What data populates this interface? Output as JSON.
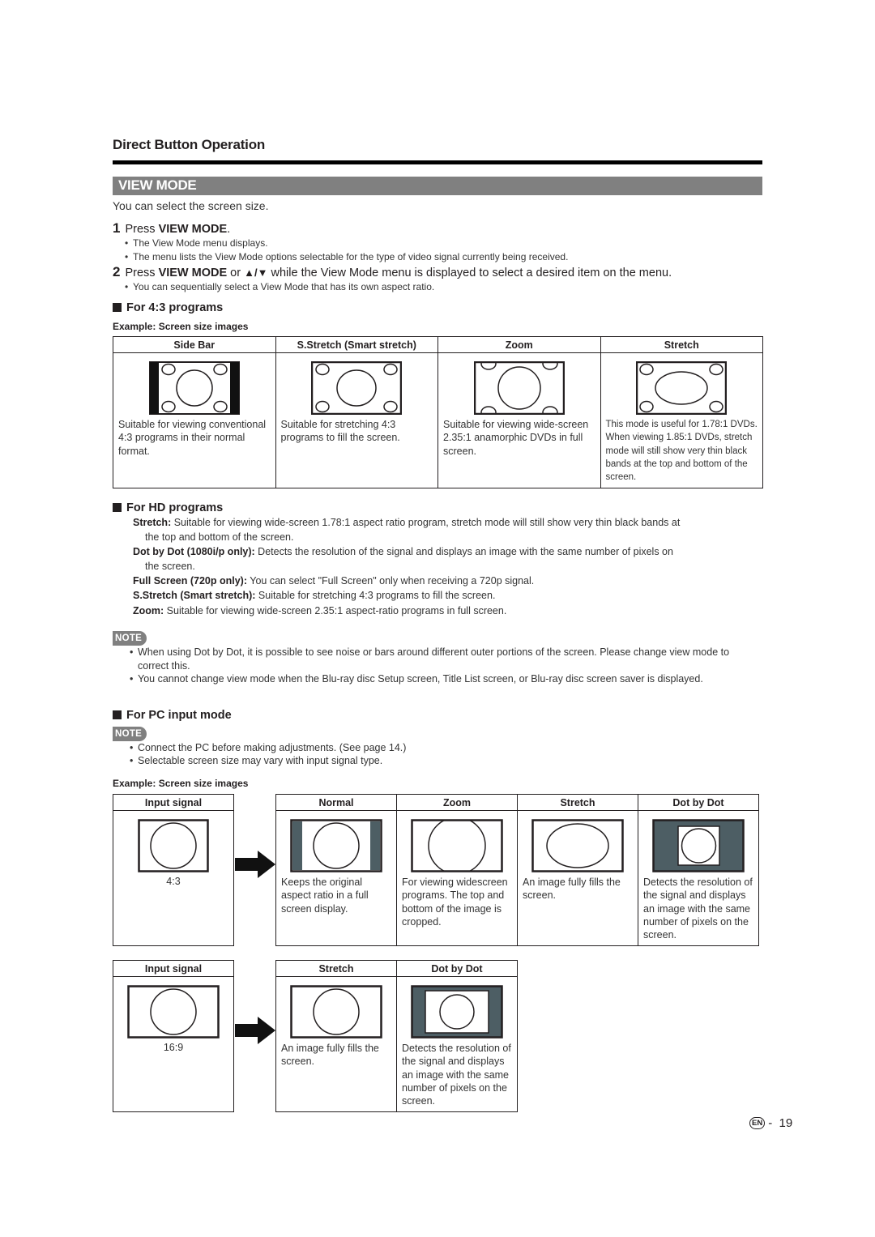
{
  "section_title": "Direct Button Operation",
  "heading": "VIEW MODE",
  "intro": "You can select the screen size.",
  "steps": [
    {
      "num": "1",
      "pre": "Press ",
      "bold": "VIEW MODE",
      "post": ".",
      "bullets": [
        "The View Mode menu displays.",
        "The menu lists the View Mode options selectable for the type of video signal currently being received."
      ]
    },
    {
      "num": "2",
      "pre": "Press ",
      "bold": "VIEW MODE",
      "mid": " or ",
      "arrows": "▲/▼",
      "post": " while the View Mode menu is displayed to select a desired item on the menu.",
      "bullets": [
        "You can sequentially select a View Mode that has its own aspect ratio."
      ]
    }
  ],
  "section_43": {
    "title": "For 4:3 programs",
    "example_label": "Example: Screen size images",
    "columns": [
      {
        "header": "Side Bar",
        "icon": "side-bar-screen-icon",
        "desc": "Suitable for viewing conventional 4:3 programs in their normal format."
      },
      {
        "header": "S.Stretch (Smart stretch)",
        "icon": "smart-stretch-screen-icon",
        "desc": "Suitable for stretching 4:3 programs to fill the screen."
      },
      {
        "header": "Zoom",
        "icon": "zoom-screen-icon",
        "desc": "Suitable for viewing wide-screen 2.35:1 anamorphic DVDs in full screen."
      },
      {
        "header": "Stretch",
        "icon": "stretch-screen-icon",
        "desc": "This mode is useful for 1.78:1 DVDs. When viewing 1.85:1 DVDs, stretch mode will still show very thin black bands at the top and bottom of the screen."
      }
    ]
  },
  "section_hd": {
    "title": "For HD programs",
    "items": [
      {
        "label": "Stretch:",
        "text": " Suitable for viewing wide-screen 1.78:1 aspect ratio program, stretch mode will still show very thin black bands at",
        "cont": "the top and bottom of the screen."
      },
      {
        "label": "Dot by Dot (1080i/p only):",
        "text": " Detects the resolution of the signal and displays an image with the same number of pixels on",
        "cont": "the screen."
      },
      {
        "label": "Full Screen (720p only):",
        "text": " You can select \"Full Screen\" only when receiving a 720p signal.",
        "cont": ""
      },
      {
        "label": "S.Stretch (Smart stretch):",
        "text": " Suitable for stretching 4:3 programs to fill the screen.",
        "cont": ""
      },
      {
        "label": "Zoom:",
        "text": " Suitable for viewing wide-screen 2.35:1 aspect-ratio programs in full screen.",
        "cont": ""
      }
    ],
    "note_label": "NOTE",
    "notes": [
      "When using Dot by Dot, it is possible to see noise or bars around different outer portions of the screen. Please change view mode to correct this.",
      "You cannot change view mode when the Blu-ray disc Setup screen, Title List screen, or Blu-ray disc screen saver is displayed."
    ]
  },
  "section_pc": {
    "title": "For PC input mode",
    "note_label": "NOTE",
    "notes": [
      "Connect the PC before making adjustments. (See page 14.)",
      "Selectable screen size may vary with input signal type."
    ],
    "example_label": "Example: Screen size images",
    "table_43": {
      "input_header": "Input signal",
      "input_ratio": "4:3",
      "columns": [
        {
          "header": "Normal",
          "desc": "Keeps the original aspect ratio in a full screen display."
        },
        {
          "header": "Zoom",
          "desc": "For viewing widescreen programs. The top and bottom of the image is cropped."
        },
        {
          "header": "Stretch",
          "desc": "An image fully fills the screen."
        },
        {
          "header": "Dot by Dot",
          "desc": "Detects the resolution of the signal and displays an image with the same number of pixels on the screen."
        }
      ]
    },
    "table_169": {
      "input_header": "Input signal",
      "input_ratio": "16:9",
      "columns": [
        {
          "header": "Stretch",
          "desc": "An image fully fills the screen."
        },
        {
          "header": "Dot by Dot",
          "desc": "Detects the resolution of the signal and displays an image with the same number of pixels on the screen."
        }
      ]
    }
  },
  "footer": {
    "lang_badge": "EN",
    "separator": "-",
    "page": "19"
  },
  "colors": {
    "heading_bar": "#808080",
    "bar_fill": "#4d5e64",
    "text": "#231f20"
  }
}
